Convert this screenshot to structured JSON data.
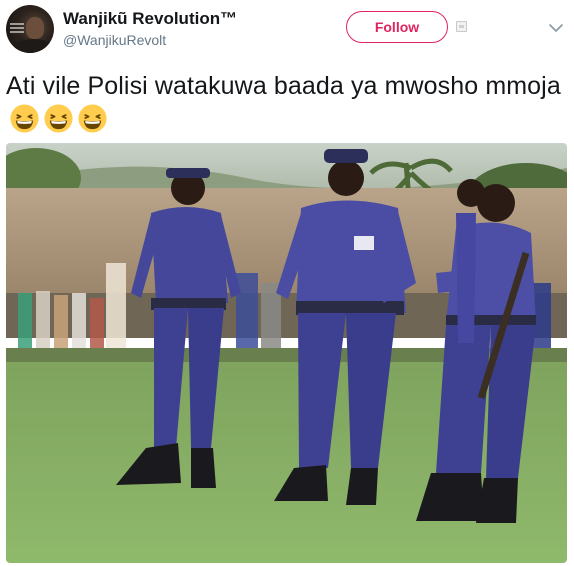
{
  "author": {
    "display_name": "Wanjikũ Revolution™",
    "handle": "@WanjikuRevolt"
  },
  "actions": {
    "follow_label": "Follow"
  },
  "tweet": {
    "text": "Ati vile Polisi watakuwa  baada ya mwosho mmoja",
    "emoji_count": 3,
    "emoji": "grinning-squinting-face"
  },
  "photo": {
    "subject": "police-officers-in-blue-uniforms-on-field"
  },
  "colors": {
    "follow_accent": "#e0245e",
    "text": "#14171a",
    "secondary_text": "#657786"
  }
}
